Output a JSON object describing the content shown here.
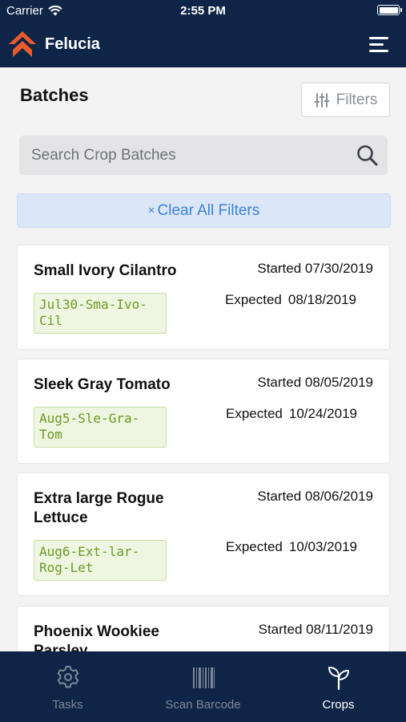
{
  "status_bar": {
    "carrier": "Carrier",
    "time": "2:55 PM"
  },
  "app": {
    "name": "Felucia",
    "accent_color": "#ea5a2a",
    "nav_color": "#0f2547"
  },
  "page": {
    "title": "Batches",
    "filters_label": "Filters"
  },
  "search": {
    "placeholder": "Search Crop Batches",
    "value": ""
  },
  "clear_filters": {
    "icon": "×",
    "label": "Clear All Filters"
  },
  "batches": [
    {
      "name": "Small Ivory Cilantro",
      "code_line1": "Jul30-Sma-Ivo-",
      "code_line2": "Cil",
      "started_label": "Started",
      "started": "07/30/2019",
      "expected_label": "Expected",
      "expected": "08/18/2019"
    },
    {
      "name": "Sleek Gray Tomato",
      "code_line1": "Aug5-Sle-Gra-",
      "code_line2": "Tom",
      "started_label": "Started",
      "started": "08/05/2019",
      "expected_label": "Expected",
      "expected": "10/24/2019"
    },
    {
      "name": "Extra large Rogue Lettuce",
      "code_line1": "Aug6-Ext-lar-",
      "code_line2": "Rog-Let",
      "started_label": "Started",
      "started": "08/06/2019",
      "expected_label": "Expected",
      "expected": "10/03/2019"
    },
    {
      "name": "Phoenix Wookiee Parsley",
      "started_label": "Started",
      "started": "08/11/2019"
    }
  ],
  "tabs": [
    {
      "label": "Tasks",
      "icon": "gear-icon",
      "active": false
    },
    {
      "label": "Scan Barcode",
      "icon": "barcode-icon",
      "active": false
    },
    {
      "label": "Crops",
      "icon": "sprout-icon",
      "active": true
    }
  ]
}
